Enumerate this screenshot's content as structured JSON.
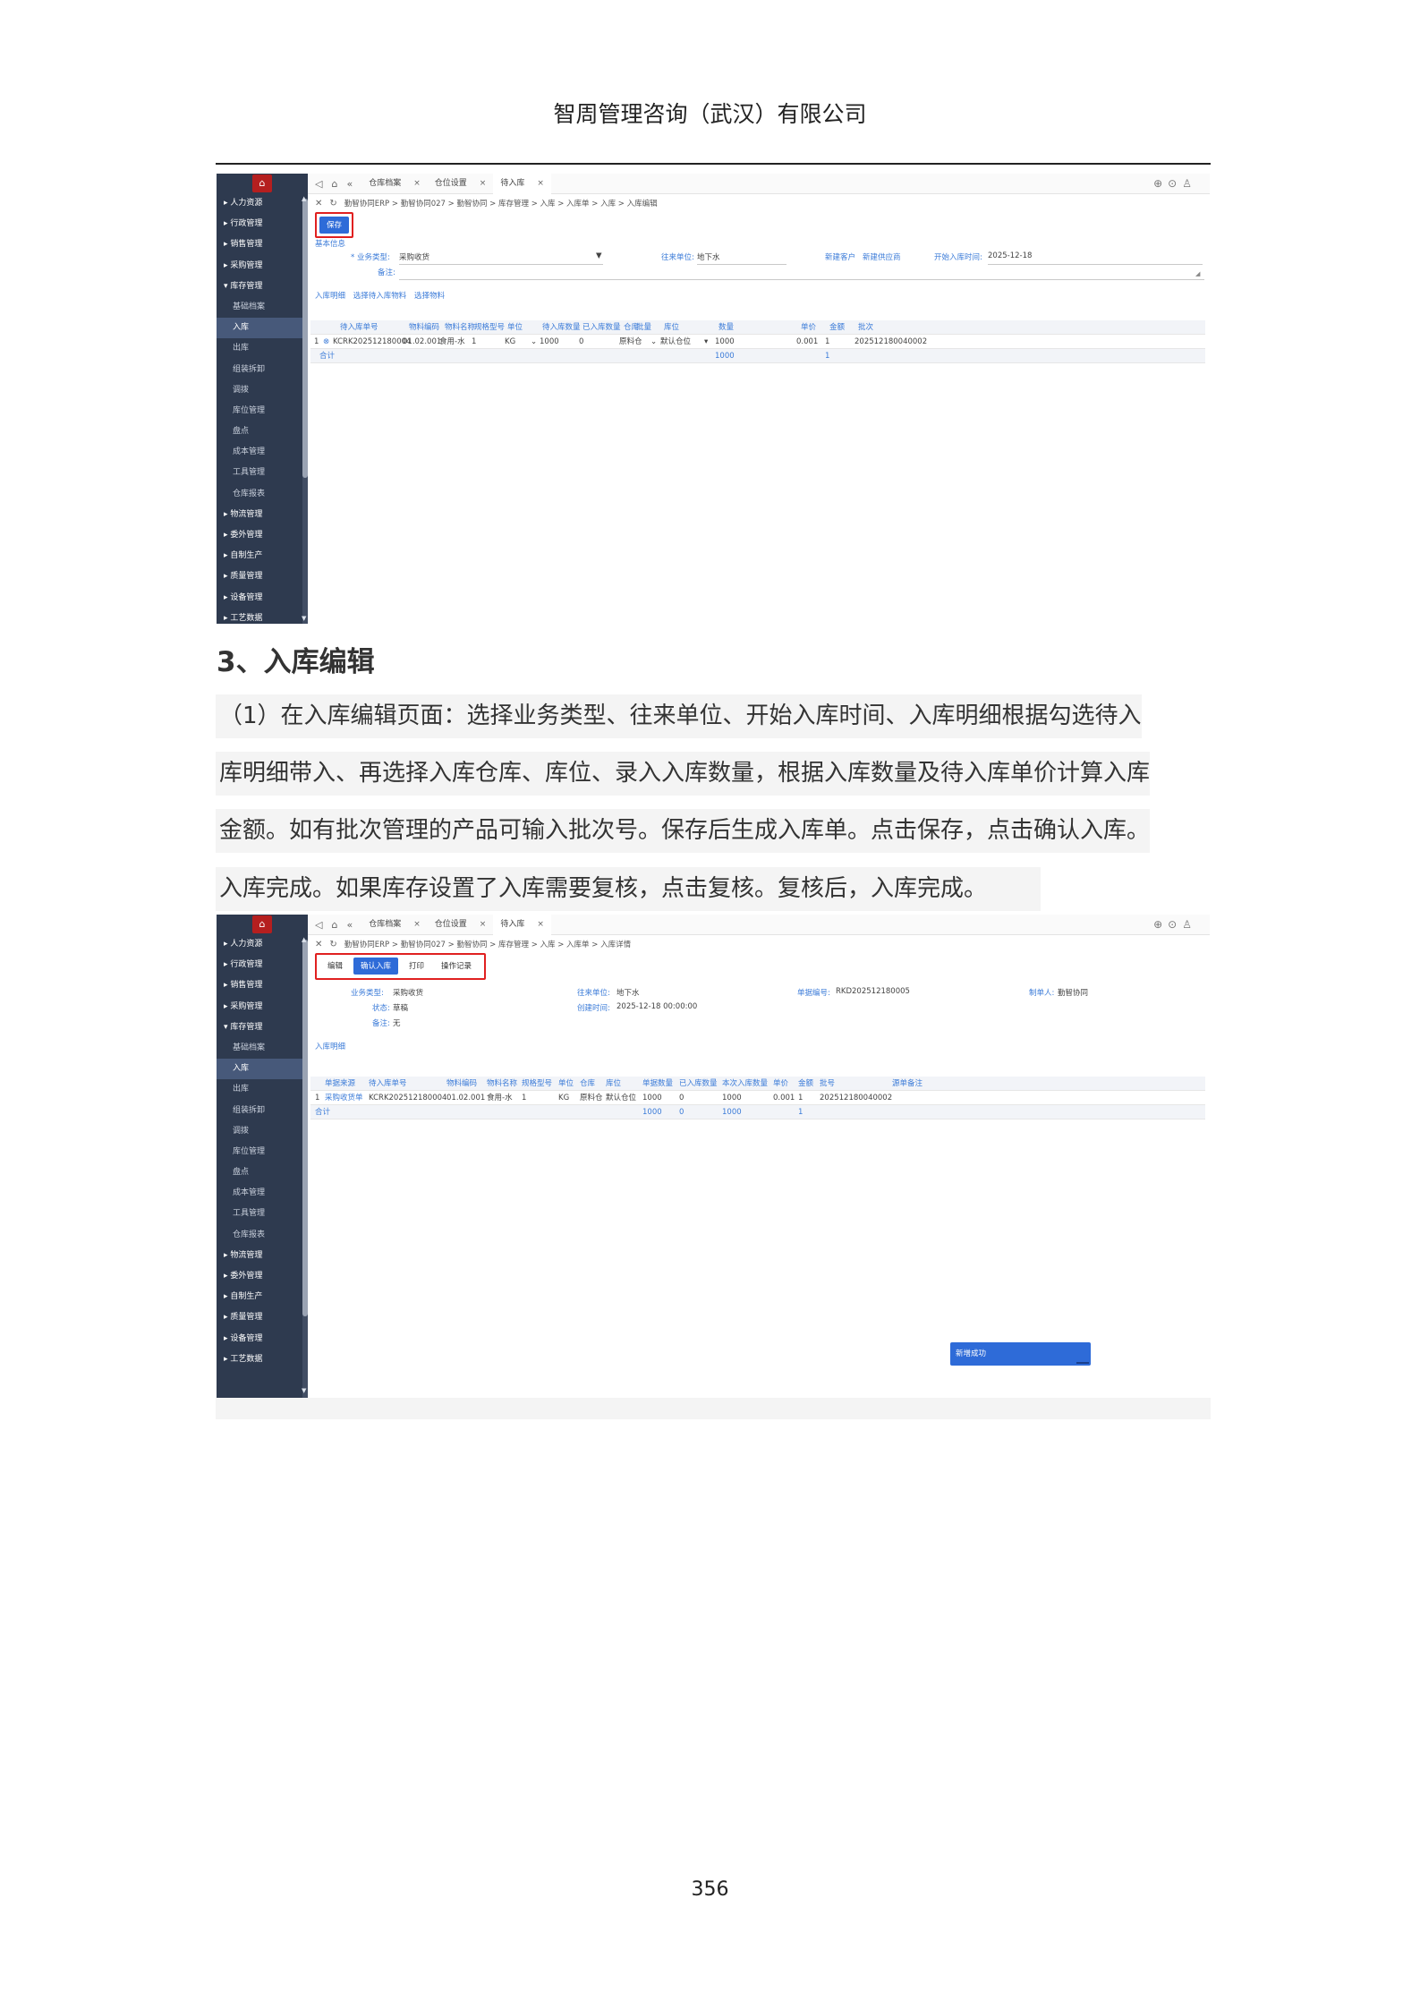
{
  "header": {
    "company": "智周管理咨询（武汉）有限公司"
  },
  "sidebar": {
    "items1": [
      "▸ 人力资源",
      "▸ 行政管理",
      "▸ 销售管理",
      "▸ 采购管理",
      "▾ 库存管理",
      "基础档案",
      "入库",
      "出库",
      "组装拆卸",
      "调拨",
      "库位管理",
      "盘点",
      "成本管理",
      "工具管理",
      "仓库报表",
      "▸ 物流管理",
      "▸ 委外管理",
      "▸ 自制生产",
      "▸ 质量管理",
      "▸ 设备管理",
      "▸ 工艺数据"
    ],
    "items2": [
      "▸ 人力资源",
      "▸ 行政管理",
      "▸ 销售管理",
      "▸ 采购管理",
      "▾ 库存管理",
      "基础档案",
      "入库",
      "出库",
      "组装拆卸",
      "调拨",
      "库位管理",
      "盘点",
      "成本管理",
      "工具管理",
      "仓库报表",
      "▸ 物流管理",
      "▸ 委外管理",
      "▸ 自制生产",
      "▸ 质量管理",
      "▸ 设备管理",
      "▸ 工艺数据"
    ]
  },
  "tabs": [
    {
      "label": "仓库档案"
    },
    {
      "label": "仓位设置"
    },
    {
      "label": "待入库"
    }
  ],
  "shot1": {
    "breadcrumb": "勤智协同ERP > 勤智协同027 > 勤智协同 > 库存管理 > 入库 > 入库单 > 入库 > 入库编辑",
    "save_label": "保存",
    "basic_info": "基本信息",
    "form": {
      "biz_type_label": "* 业务类型:",
      "biz_type_value": "采购收货",
      "partner_label": "往来单位:",
      "partner_value": "地下水",
      "new_customer": "新建客户",
      "new_supplier": "新建供应商",
      "start_time_label": "开始入库时间:",
      "start_time_value": "2025-12-18",
      "remark_label": "备注:"
    },
    "detail_title": "入库明细",
    "select_pending": "选择待入库物料",
    "select_material": "选择物料",
    "columns": [
      "待入库单号",
      "物料编码",
      "物料名称",
      "规格型号",
      "单位",
      "待入库数量",
      "已入库数量",
      "仓库",
      "批量",
      "库位",
      "数量",
      "单价",
      "金额",
      "批次"
    ],
    "row": {
      "no": "1",
      "order": "KCRK202512180004",
      "code": "01.02.001",
      "name": "食用-水",
      "spec": "1",
      "unit": "KG",
      "pending": "1000",
      "done": "0",
      "warehouse": "原料仓",
      "location": "默认仓位",
      "qty": "1000",
      "price": "0.001",
      "amount": "1",
      "batch": "202512180040002"
    },
    "total": {
      "label": "合计",
      "qty": "1000",
      "amount": "1"
    }
  },
  "shot2": {
    "breadcrumb": "勤智协同ERP > 勤智协同027 > 勤智协同 > 库存管理 > 入库 > 入库单 > 入库详情",
    "buttons": {
      "edit": "编辑",
      "confirm": "确认入库",
      "print": "打印",
      "log": "操作记录"
    },
    "info": {
      "biz_type_label": "业务类型:",
      "biz_type_value": "采购收货",
      "partner_label": "往来单位:",
      "partner_value": "地下水",
      "doc_no_label": "单据编号:",
      "doc_no_value": "RKD202512180005",
      "maker_label": "制单人:",
      "maker_value": "勤智协同",
      "status_label": "状态:",
      "status_value": "草稿",
      "created_label": "创建时间:",
      "created_value": "2025-12-18 00:00:00",
      "remark_label": "备注:",
      "remark_value": "无"
    },
    "detail_title": "入库明细",
    "columns": [
      "单据来源",
      "待入库单号",
      "物料编码",
      "物料名称",
      "规格型号",
      "单位",
      "仓库",
      "库位",
      "单据数量",
      "已入库数量",
      "本次入库数量",
      "单价",
      "金额",
      "批号",
      "源单备注"
    ],
    "row": {
      "no": "1",
      "source": "采购收货单",
      "order": "KCRK202512180004",
      "code": "01.02.001",
      "name": "食用-水",
      "spec": "1",
      "unit": "KG",
      "warehouse": "原料仓",
      "location": "默认仓位",
      "doc_qty": "1000",
      "done": "0",
      "this_qty": "1000",
      "price": "0.001",
      "amount": "1",
      "batch": "202512180040002"
    },
    "total": {
      "label": "合计",
      "doc_qty": "1000",
      "done": "0",
      "this_qty": "1000",
      "amount": "1"
    },
    "toast": "新增成功"
  },
  "body": {
    "heading": "3、入库编辑",
    "lines": [
      "（1）在入库编辑页面：选择业务类型、往来单位、开始入库时间、入库明细根据勾选待入",
      "库明细带入、再选择入库仓库、库位、录入入库数量，根据入库数量及待入库单价计算入库",
      "金额。如有批次管理的产品可输入批次号。保存后生成入库单。点击保存，点击确认入库。",
      "入库完成。如果库存设置了入库需要复核，点击复核。复核后，入库完成。"
    ]
  },
  "page_number": "356"
}
